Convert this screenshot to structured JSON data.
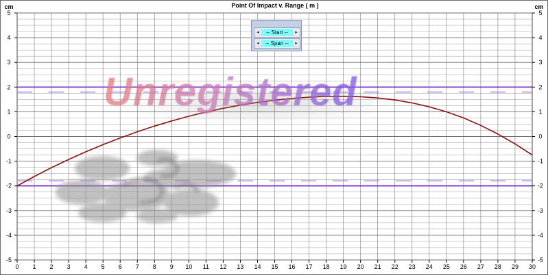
{
  "chart_data": {
    "type": "line",
    "title": "Point Of Impact v. Range ( m )",
    "ylabel_left": "cm",
    "ylabel_right": "cm",
    "xlim": [
      0,
      30
    ],
    "ylim": [
      -5,
      5
    ],
    "x_ticks": [
      "0",
      "1",
      "2",
      "3",
      "4",
      "5",
      "6",
      "7",
      "8",
      "9",
      "10",
      "11",
      "12",
      "13",
      "14",
      "15",
      "16",
      "17",
      "18",
      "19",
      "20",
      "21",
      "22",
      "23",
      "24",
      "25",
      "26",
      "27",
      "28",
      "29",
      "30"
    ],
    "y_ticks": [
      "5",
      "4",
      "3",
      "2",
      "1",
      "0",
      "-1",
      "-2",
      "-3",
      "-4",
      "-5"
    ],
    "grid": true,
    "series": [
      {
        "color": "#8b1010",
        "x": [
          0,
          1,
          2,
          3,
          4,
          5,
          6,
          7,
          8,
          9,
          10,
          11,
          12,
          13,
          14,
          15,
          16,
          17,
          18,
          19,
          20,
          21,
          22,
          23,
          24,
          25,
          26,
          27,
          28,
          29,
          30
        ],
        "values": [
          -2.0,
          -1.62,
          -1.26,
          -0.93,
          -0.62,
          -0.33,
          -0.06,
          0.19,
          0.42,
          0.63,
          0.82,
          0.99,
          1.14,
          1.27,
          1.38,
          1.47,
          1.54,
          1.59,
          1.62,
          1.63,
          1.61,
          1.56,
          1.48,
          1.36,
          1.2,
          1.0,
          0.75,
          0.45,
          0.1,
          -0.3,
          -0.75
        ]
      }
    ],
    "reference_lines": [
      {
        "y": 2,
        "color": "#7a2fd0",
        "style": "solid"
      },
      {
        "y": -2,
        "color": "#7a2fd0",
        "style": "solid"
      },
      {
        "y": 1.8,
        "color": "#9c7fe0",
        "style": "dashed"
      },
      {
        "y": -1.8,
        "color": "#9c7fe0",
        "style": "dashed"
      }
    ]
  },
  "controls": {
    "start_label": "-- Start --",
    "span_label": "-- Span --",
    "left_arrow": "◂",
    "right_arrow": "▸"
  },
  "watermark": {
    "text": "Unregistered",
    "colors": [
      "#e27a7a",
      "#7b55e0"
    ]
  }
}
